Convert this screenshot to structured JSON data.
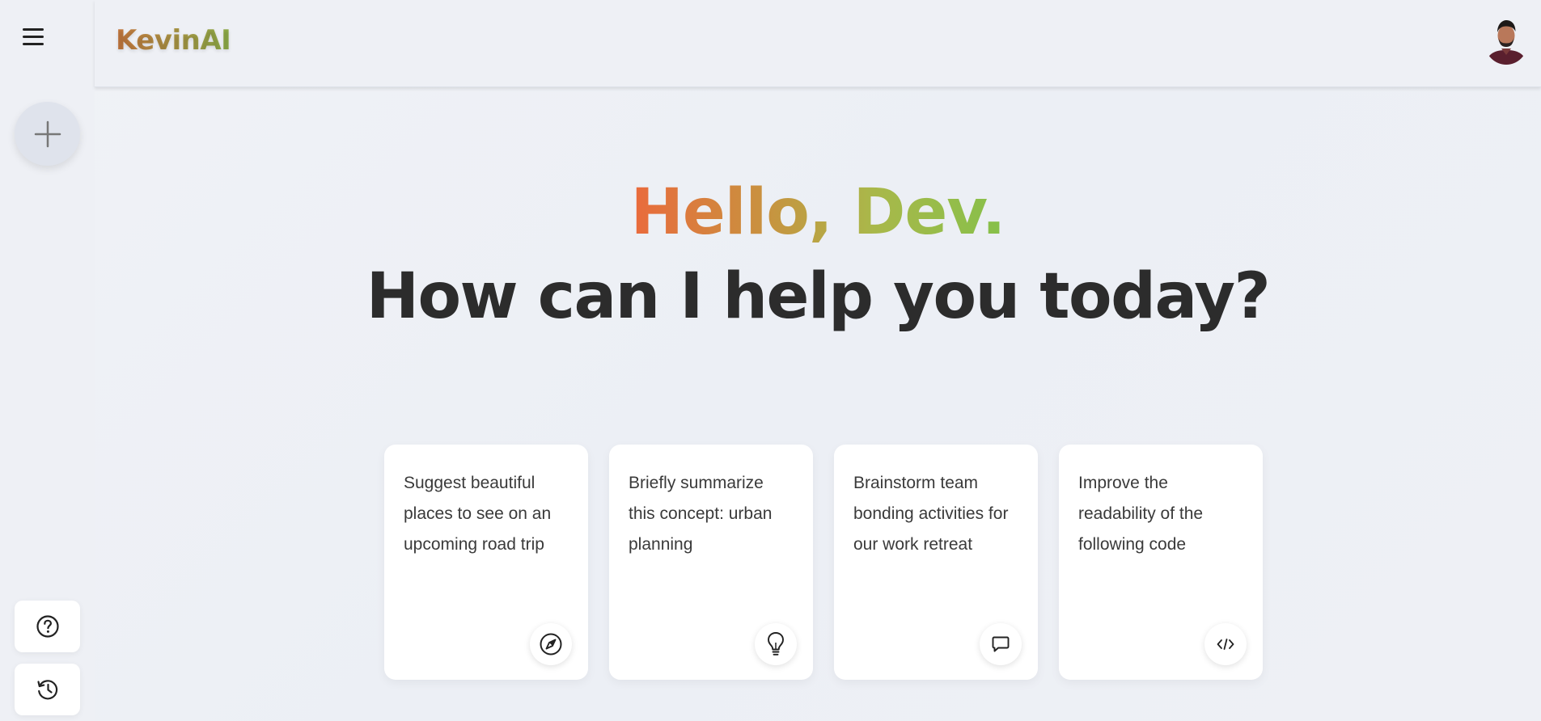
{
  "header": {
    "brand": "KevinAI"
  },
  "hero": {
    "greeting": "Hello, Dev.",
    "subtitle": "How can I help you today?"
  },
  "cards": [
    {
      "text": "Suggest beautiful places to see on an upcoming road trip",
      "icon": "compass-icon"
    },
    {
      "text": "Briefly summarize this concept: urban planning",
      "icon": "lightbulb-icon"
    },
    {
      "text": "Brainstorm team bonding activities for our work retreat",
      "icon": "chat-icon"
    },
    {
      "text": "Improve the readability of the following code",
      "icon": "code-icon"
    }
  ],
  "sidebar": {
    "menu_icon": "hamburger-icon",
    "new_chat_icon": "plus-icon",
    "help_icon": "help-icon",
    "history_icon": "history-icon"
  },
  "colors": {
    "background": "#eef0f5",
    "brand_gradient_start": "#c8793f",
    "brand_gradient_end": "#8fb04a",
    "greeting_gradient_start": "#ea6a3c",
    "greeting_gradient_end": "#86c04a",
    "heading": "#2c2c2c"
  }
}
